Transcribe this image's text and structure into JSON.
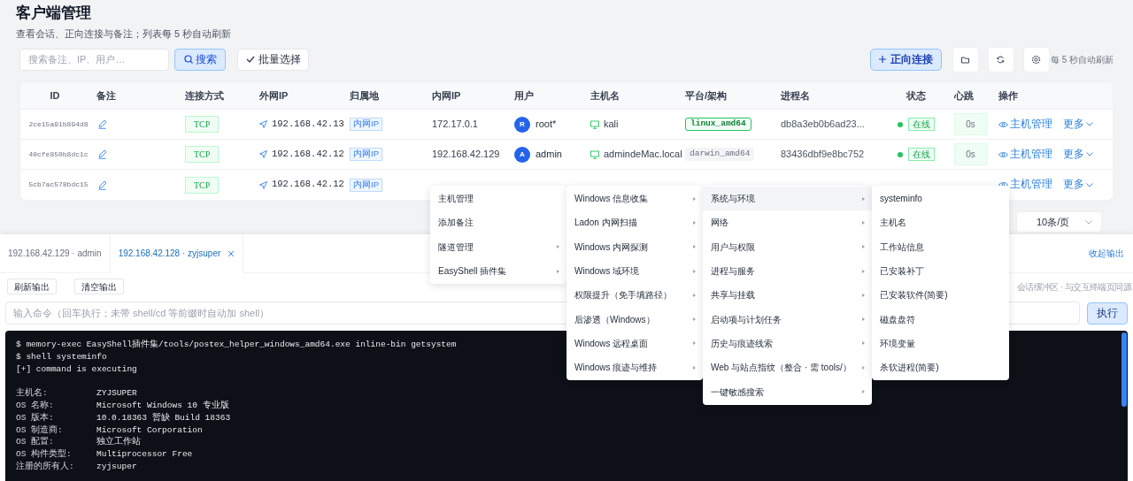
{
  "page": {
    "title": "客户端管理",
    "subtitle": "查看会话、正向连接与备注；列表每 5 秒自动刷新"
  },
  "toolbar": {
    "search": {
      "placeholder": "搜索备注、IP、用户…"
    },
    "search_button": "搜索",
    "batch_button": "批量选择",
    "connect_button": "正向连接",
    "refresh_hint": "每 5 秒自动刷新"
  },
  "table": {
    "columns": [
      "ID",
      "备注",
      "连接方式",
      "外网IP",
      "归属地",
      "内网IP",
      "用户",
      "主机名",
      "平台/架构",
      "进程名",
      "状态",
      "心跳",
      "操作"
    ],
    "rows": [
      {
        "id": "2ce15a91b894d8",
        "connection": "TCP",
        "external_ip": "192.168.42.13",
        "location": "内网IP",
        "internal_ip": "172.17.0.1",
        "user": {
          "initial": "R",
          "name": "root*"
        },
        "hostname": "kali",
        "platform": {
          "label": "linux_amd64",
          "highlighted": true
        },
        "process": "db8a3eb0b6ad23...",
        "status": {
          "label": "在线",
          "online": true
        },
        "heartbeat": "0s",
        "actions": {
          "manage": "主机管理",
          "more": "更多"
        }
      },
      {
        "id": "40cfe850b8dc1c",
        "connection": "TCP",
        "external_ip": "192.168.42.12",
        "location": "内网IP",
        "internal_ip": "192.168.42.129",
        "user": {
          "initial": "A",
          "name": "admin"
        },
        "hostname": "admindeMac.local",
        "platform": {
          "label": "darwin_amd64",
          "highlighted": false
        },
        "process": "83436dbf9e8bc752",
        "status": {
          "label": "在线",
          "online": true
        },
        "heartbeat": "0s",
        "actions": {
          "manage": "主机管理",
          "more": "更多"
        }
      },
      {
        "id": "5cb7ac578bdc15",
        "connection": "TCP",
        "external_ip": "192.168.42.12",
        "location": "内网IP",
        "actions": {
          "manage": "主机管理",
          "more": "更多"
        }
      }
    ]
  },
  "pagination": {
    "page_size": "10条/页"
  },
  "console": {
    "tabs": [
      {
        "label": "192.168.42.129 · admin",
        "selected": false
      },
      {
        "label": "192.168.42.128 · zyjsuper",
        "selected": true
      }
    ],
    "collapse_link": "收起输出",
    "buttons": [
      "刷新输出",
      "清空输出"
    ],
    "hint": "会话缓冲区 · 与交互终端页同源",
    "command_input": {
      "placeholder": "输入命令（回车执行；未带 shell/cd 等前缀时自动加 shell）"
    },
    "run_button": "执行",
    "output": [
      {
        "kind": "text",
        "text": "$ memory-exec EasyShell插件集/tools/postex_helper_windows_amd64.exe inline-bin getsystem"
      },
      {
        "kind": "text",
        "text": "$ shell systeminfo"
      },
      {
        "kind": "text",
        "text": "[+] command is executing"
      },
      {
        "kind": "gap"
      },
      {
        "kind": "field",
        "label": "主机名:",
        "value": "ZYJSUPER"
      },
      {
        "kind": "field",
        "label": "OS 名称:",
        "value": "Microsoft Windows 10 专业版"
      },
      {
        "kind": "field",
        "label": "OS 版本:",
        "value": "10.0.18363 暂缺 Build 18363"
      },
      {
        "kind": "field",
        "label": "OS 制造商:",
        "value": "Microsoft Corporation"
      },
      {
        "kind": "field",
        "label": "OS 配置:",
        "value": "独立工作站"
      },
      {
        "kind": "field",
        "label": "OS 构件类型:",
        "value": "Multiprocessor Free"
      },
      {
        "kind": "field",
        "label": "注册的所有人:",
        "value": "zyjsuper"
      }
    ]
  },
  "context_menus": [
    {
      "items": [
        {
          "label": "主机管理",
          "submenu": false,
          "selected": false
        },
        {
          "label": "添加备注",
          "submenu": false,
          "selected": false
        },
        {
          "label": "隧道管理",
          "submenu": true,
          "selected": false
        },
        {
          "label": "EasyShell 插件集",
          "submenu": true,
          "selected": false
        }
      ]
    },
    {
      "items": [
        {
          "label": "Windows 信息收集",
          "submenu": true,
          "selected": false
        },
        {
          "label": "Ladon 内网扫描",
          "submenu": true,
          "selected": false
        },
        {
          "label": "Windows 内网探测",
          "submenu": true,
          "selected": false
        },
        {
          "label": "Windows 域环境",
          "submenu": true,
          "selected": false
        },
        {
          "label": "权限提升（免手填路径）",
          "submenu": true,
          "selected": false
        },
        {
          "label": "后渗透（Windows）",
          "submenu": true,
          "selected": false
        },
        {
          "label": "Windows 远程桌面",
          "submenu": true,
          "selected": false
        },
        {
          "label": "Windows 痕迹与维持",
          "submenu": true,
          "selected": false
        }
      ]
    },
    {
      "items": [
        {
          "label": "系统与环境",
          "submenu": true,
          "selected": true
        },
        {
          "label": "网络",
          "submenu": true,
          "selected": false
        },
        {
          "label": "用户与权限",
          "submenu": true,
          "selected": false
        },
        {
          "label": "进程与服务",
          "submenu": true,
          "selected": false
        },
        {
          "label": "共享与挂载",
          "submenu": true,
          "selected": false
        },
        {
          "label": "启动项与计划任务",
          "submenu": true,
          "selected": false
        },
        {
          "label": "历史与痕迹线索",
          "submenu": true,
          "selected": false
        },
        {
          "label": "Web 与站点指纹（整合 · 需 tools/）",
          "submenu": true,
          "selected": false
        },
        {
          "label": "一键敏感搜索",
          "submenu": true,
          "selected": false
        }
      ]
    },
    {
      "items": [
        {
          "label": "systeminfo",
          "submenu": false,
          "selected": false
        },
        {
          "label": "主机名",
          "submenu": false,
          "selected": false
        },
        {
          "label": "工作站信息",
          "submenu": false,
          "selected": false
        },
        {
          "label": "已安装补丁",
          "submenu": false,
          "selected": false
        },
        {
          "label": "已安装软件(简要)",
          "submenu": false,
          "selected": false
        },
        {
          "label": "磁盘盘符",
          "submenu": false,
          "selected": false
        },
        {
          "label": "环境变量",
          "submenu": false,
          "selected": false
        },
        {
          "label": "杀软进程(简要)",
          "submenu": false,
          "selected": false
        }
      ]
    }
  ]
}
